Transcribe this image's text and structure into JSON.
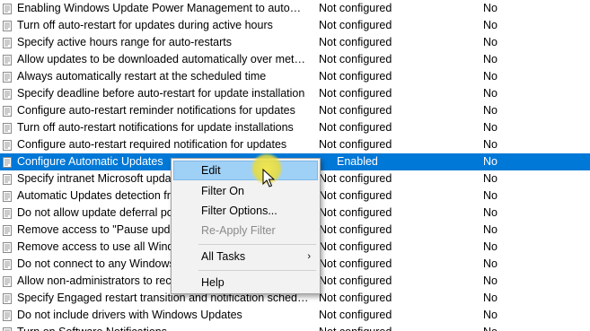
{
  "rows": [
    {
      "setting": "Enabling Windows Update Power Management to automatically wake up the system",
      "state": "Not configured",
      "comment": "No",
      "selected": false
    },
    {
      "setting": "Turn off auto-restart for updates during active hours",
      "state": "Not configured",
      "comment": "No",
      "selected": false
    },
    {
      "setting": "Specify active hours range for auto-restarts",
      "state": "Not configured",
      "comment": "No",
      "selected": false
    },
    {
      "setting": "Allow updates to be downloaded automatically over metered connections",
      "state": "Not configured",
      "comment": "No",
      "selected": false
    },
    {
      "setting": "Always automatically restart at the scheduled time",
      "state": "Not configured",
      "comment": "No",
      "selected": false
    },
    {
      "setting": "Specify deadline before auto-restart for update installation",
      "state": "Not configured",
      "comment": "No",
      "selected": false
    },
    {
      "setting": "Configure auto-restart reminder notifications for updates",
      "state": "Not configured",
      "comment": "No",
      "selected": false
    },
    {
      "setting": "Turn off auto-restart notifications for update installations",
      "state": "Not configured",
      "comment": "No",
      "selected": false
    },
    {
      "setting": "Configure auto-restart required notification for updates",
      "state": "Not configured",
      "comment": "No",
      "selected": false
    },
    {
      "setting": "Configure Automatic Updates",
      "state": "Enabled",
      "comment": "No",
      "selected": true
    },
    {
      "setting": "Specify intranet Microsoft update",
      "state": "Not configured",
      "comment": "No",
      "selected": false
    },
    {
      "setting": "Automatic Updates detection fre",
      "state": "Not configured",
      "comment": "No",
      "selected": false
    },
    {
      "setting": "Do not allow update deferral pol",
      "state": "Not configured",
      "comment": "No",
      "selected": false
    },
    {
      "setting": "Remove access to \"Pause update",
      "state": "Not configured",
      "comment": "No",
      "selected": false
    },
    {
      "setting": "Remove access to use all Windo",
      "state": "Not configured",
      "comment": "No",
      "selected": false
    },
    {
      "setting": "Do not connect to any Windows",
      "state": "Not configured",
      "comment": "No",
      "selected": false
    },
    {
      "setting": "Allow non-administrators to rece",
      "state": "Not configured",
      "comment": "No",
      "selected": false
    },
    {
      "setting": "Specify Engaged restart transition and notification schedule for updates",
      "state": "Not configured",
      "comment": "No",
      "selected": false
    },
    {
      "setting": "Do not include drivers with Windows Updates",
      "state": "Not configured",
      "comment": "No",
      "selected": false
    },
    {
      "setting": "Turn on Software Notifications",
      "state": "Not configured",
      "comment": "No",
      "selected": false
    }
  ],
  "context_menu": {
    "edit": "Edit",
    "filter_on": "Filter On",
    "filter_options": "Filter Options...",
    "reapply_filter": "Re-Apply Filter",
    "all_tasks": "All Tasks",
    "all_tasks_arrow": "›",
    "help": "Help"
  },
  "colors": {
    "selection": "#0078d7",
    "menu_hover": "#9fd0f5",
    "click_highlight": "#f5e846"
  },
  "icons": {
    "row_icon": "policy-setting-icon",
    "cursor": "mouse-pointer-icon"
  }
}
